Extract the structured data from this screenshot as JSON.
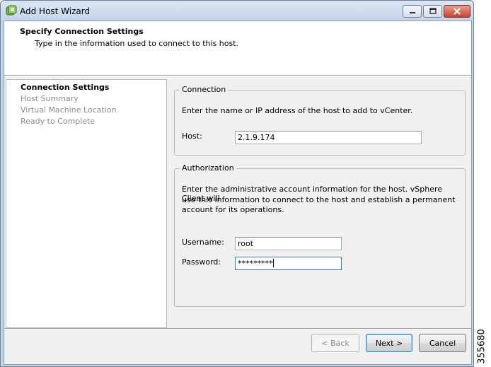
{
  "window": {
    "title": "Add Host Wizard"
  },
  "header": {
    "title": "Specify Connection Settings",
    "subtitle": "Type in the information used to connect to this host."
  },
  "steps": [
    {
      "label": "Connection Settings",
      "current": true
    },
    {
      "label": "Host Summary",
      "current": false
    },
    {
      "label": "Virtual Machine Location",
      "current": false
    },
    {
      "label": "Ready to Complete",
      "current": false
    }
  ],
  "connection": {
    "legend": "Connection",
    "description": "Enter the name or IP address of the host to add to vCenter.",
    "host_label": "Host:",
    "host_value": "2.1.9.174"
  },
  "authorization": {
    "legend": "Authorization",
    "description_lines": [
      "Enter the administrative account information for the host. vSphere Client will",
      "use this information to connect to the host and establish a permanent",
      "account for its operations."
    ],
    "username_label": "Username:",
    "username_value": "root",
    "password_label": "Password:",
    "password_value": "*********"
  },
  "buttons": {
    "back": "< Back",
    "next": "Next >",
    "cancel": "Cancel"
  },
  "figure_number": "355680",
  "colors": {
    "title_bar": "#c4d5e8",
    "panel_bg": "#f0f0f0",
    "close_button": "#c7452b",
    "focus_border": "#3c7fb1"
  },
  "icons": {
    "app": "vsphere-app-icon",
    "minimize": "minimize-icon",
    "maximize": "maximize-icon",
    "close": "close-icon"
  }
}
